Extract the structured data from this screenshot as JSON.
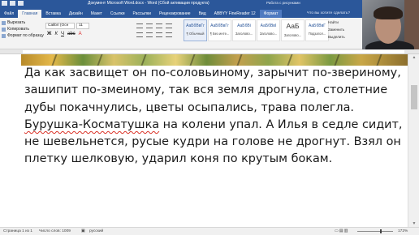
{
  "titlebar": {
    "document_title": "Документ Microsoft Word.docx - Word (Сбой активации продукта)",
    "context_title": "Работа с рисунками"
  },
  "tabs": [
    {
      "label": "Файл"
    },
    {
      "label": "Главная"
    },
    {
      "label": "Вставка"
    },
    {
      "label": "Дизайн"
    },
    {
      "label": "Макет"
    },
    {
      "label": "Ссылки"
    },
    {
      "label": "Рассылки"
    },
    {
      "label": "Рецензирование"
    },
    {
      "label": "Вид"
    },
    {
      "label": "ABBYY FineReader 12"
    },
    {
      "label": "Формат"
    }
  ],
  "tell_me": "Что вы хотите сделать?",
  "clipboard": {
    "cut": "Вырезать",
    "copy": "Копировать",
    "format_painter": "Формат по образцу"
  },
  "font": {
    "name": "Calibri (Осн",
    "size": "11",
    "buttons": [
      "Ж",
      "К",
      "Ч",
      "abc",
      "A"
    ]
  },
  "styles": [
    {
      "sample": "АаБбВвГг",
      "name": "¶ Обычный"
    },
    {
      "sample": "АаБбВвГг",
      "name": "¶ Без инте..."
    },
    {
      "sample": "АаБбВі",
      "name": "Заголово..."
    },
    {
      "sample": "АаБбВвІ",
      "name": "Заголово..."
    },
    {
      "sample": "АаБ",
      "name": "Заголово..."
    },
    {
      "sample": "АаБбВвГ",
      "name": "Подзагол..."
    }
  ],
  "editing": {
    "find": "Найти",
    "replace": "Заменить",
    "select": "Выделить"
  },
  "groups": {
    "clipboard": "Буфер обмена",
    "font": "Шрифт",
    "paragraph": "Абзац",
    "styles": "Стили",
    "editing": "Редактирование"
  },
  "document": {
    "lines": [
      "Да как засвищет он по-соловьиному, зарычит по-звериному,",
      "зашипит по-змеиному, так вся земля дрогнула, столетние",
      "дубы покачнулись, цветы осыпались, трава полегла.",
      "Бурушка-Косматушка на колени упал. А Илья в седле сидит,",
      "не шевельнется, русые кудри на голове не дрогнут. Взял он",
      "плетку шелковую, ударил коня по крутым бокам."
    ],
    "misspelled": "Бурушка-Косматушка",
    "line4_rest": " на колени упал. А Илья в седле сидит,"
  },
  "statusbar": {
    "page": "Страница 1 из 1",
    "words": "Число слов: 1009",
    "language": "русский",
    "zoom": "172%"
  },
  "colors": {
    "accent": "#2b579a",
    "spellcheck": "#d93025"
  }
}
